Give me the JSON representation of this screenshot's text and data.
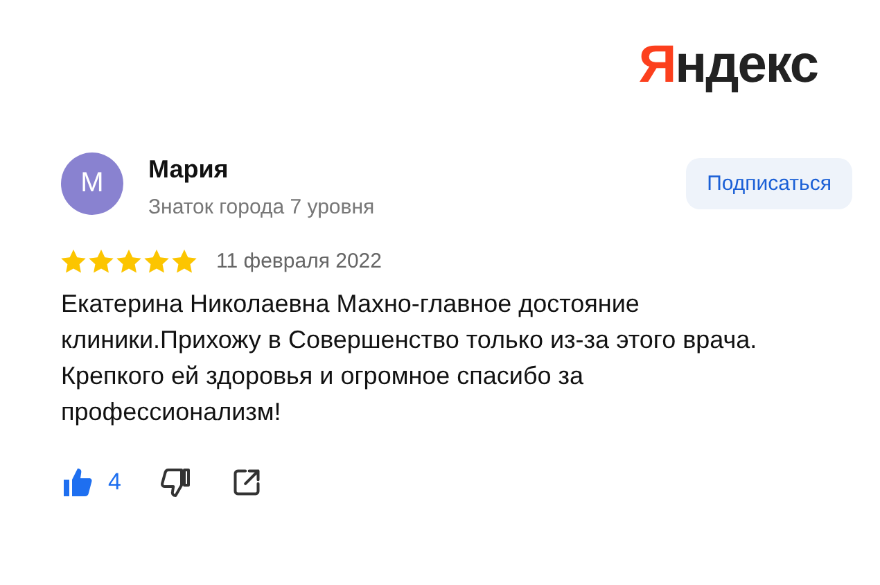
{
  "logo": "Яндекс",
  "author": {
    "initial": "М",
    "name": "Мария",
    "badge": "Знаток города 7 уровня"
  },
  "subscribe_button": "Подписаться",
  "rating": {
    "stars": 5
  },
  "date": "11 февраля 2022",
  "text": "Екатерина Николаевна Махно-главное достояние клиники.Прихожу в Совершенство только из-за этого врача. Крепкого ей здоровья и огромное спасибо за профессионализм!",
  "actions": {
    "like": {
      "liked": true,
      "count": "4"
    },
    "dislike": {
      "disliked": false
    }
  }
}
